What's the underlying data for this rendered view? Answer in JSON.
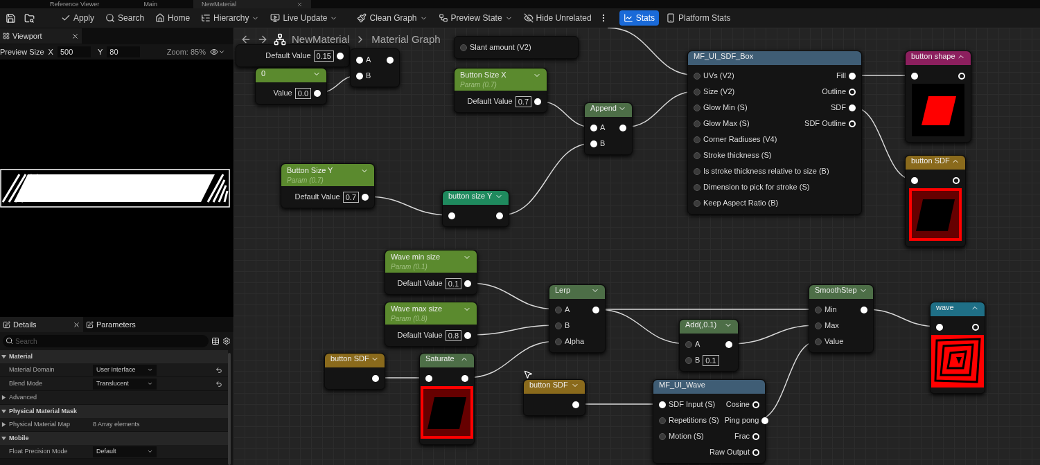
{
  "tabs": [
    {
      "label": "Reference Viewer",
      "selected": false
    },
    {
      "label": "Main",
      "selected": false
    },
    {
      "label": "NewMaterial",
      "selected": true
    }
  ],
  "toolbar": [
    {
      "label": "Apply",
      "dropdown": false,
      "selected": false
    },
    {
      "label": "Search",
      "dropdown": false,
      "selected": false
    },
    {
      "label": "Home",
      "dropdown": false,
      "selected": false
    },
    {
      "label": "Hierarchy",
      "dropdown": true,
      "selected": false
    },
    {
      "label": "Live Update",
      "dropdown": true,
      "selected": false
    },
    {
      "label": "Clean Graph",
      "dropdown": true,
      "selected": false
    },
    {
      "label": "Preview State",
      "dropdown": true,
      "selected": false
    },
    {
      "label": "Hide Unrelated",
      "dropdown": false,
      "selected": false
    },
    {
      "label": "Stats",
      "dropdown": false,
      "selected": true
    },
    {
      "label": "Platform Stats",
      "dropdown": false,
      "selected": false
    }
  ],
  "viewport": {
    "title": "Viewport",
    "preview_size_label": "Preview Size",
    "x_label": "X",
    "x_value": "500",
    "y_label": "Y",
    "y_value": "80",
    "zoom": "Zoom: 85%"
  },
  "details": {
    "tabs": [
      {
        "label": "Details",
        "selected": true
      },
      {
        "label": "Parameters",
        "selected": false
      }
    ],
    "search_placeholder": "Search",
    "sections": [
      {
        "title": "Material",
        "expanded": true,
        "rows": [
          {
            "kind": "dropdown",
            "label": "Material Domain",
            "value": "User Interface",
            "reset": true
          },
          {
            "kind": "dropdown",
            "label": "Blend Mode",
            "value": "Translucent",
            "reset": true
          },
          {
            "kind": "group",
            "label": "Advanced",
            "expanded": false
          }
        ]
      },
      {
        "title": "Physical Material Mask",
        "expanded": true,
        "rows": [
          {
            "kind": "array",
            "label": "Physical Material Map",
            "value": "8 Array elements",
            "expanded": false
          }
        ]
      },
      {
        "title": "Mobile",
        "expanded": true,
        "rows": [
          {
            "kind": "dropdown",
            "label": "Float Precision Mode",
            "value": "Default",
            "reset": false
          }
        ]
      }
    ]
  },
  "graph": {
    "breadcrumb": [
      "NewMaterial",
      "Material Graph"
    ],
    "nodes": [
      {
        "rows": [
          {
            "output": {
              "label": "Default Value",
              "value": "0.15",
              "filled": true
            }
          }
        ]
      },
      {
        "rows": [
          {
            "input": {
              "label": "A",
              "filled": true
            },
            "output": {
              "filled": true
            }
          },
          {
            "input": {
              "label": "B",
              "filled": true
            }
          }
        ]
      },
      {
        "rows": [
          {
            "input": {
              "label": "Slant amount (V2)",
              "filled": false
            }
          }
        ]
      },
      {
        "title": "0",
        "color": "#5b8a2e",
        "expanded": false,
        "rows": [
          {
            "output": {
              "label": "Value",
              "value": "0.0",
              "filled": true
            }
          }
        ]
      },
      {
        "title": "Button Size X",
        "subtitle": "Param (0.7)",
        "color": "#5b8a2e",
        "expanded": false,
        "rows": [
          {
            "output": {
              "label": "Default Value",
              "value": "0.7",
              "filled": true
            }
          }
        ]
      },
      {
        "title": "Append",
        "color": "#4d6e47",
        "expanded": false,
        "rows": [
          {
            "input": {
              "label": "A",
              "filled": true
            },
            "output": {
              "filled": true
            }
          },
          {
            "input": {
              "label": "B",
              "filled": true
            }
          }
        ]
      },
      {
        "title": "Button Size Y",
        "subtitle": "Param (0.7)",
        "color": "#5b8a2e",
        "expanded": false,
        "rows": [
          {
            "output": {
              "label": "Default Value",
              "value": "0.7",
              "filled": true
            }
          }
        ]
      },
      {
        "title": "button size Y",
        "color": "#1f8a5e",
        "expanded": false,
        "rows": [
          {
            "input": {
              "filled": true
            },
            "output": {
              "filled": true
            }
          }
        ]
      },
      {
        "title": "MF_UI_SDF_Box",
        "color": "#3f5d75",
        "rows": [
          {
            "input": {
              "label": "UVs (V2)",
              "filled": false
            },
            "output": {
              "label": "Fill",
              "filled": true
            }
          },
          {
            "input": {
              "label": "Size (V2)",
              "filled": false
            },
            "output": {
              "label": "Outline",
              "filled": false
            }
          },
          {
            "input": {
              "label": "Glow Min (S)",
              "filled": false
            },
            "output": {
              "label": "SDF",
              "filled": true
            }
          },
          {
            "input": {
              "label": "Glow Max (S)",
              "filled": false
            },
            "output": {
              "label": "SDF Outline",
              "filled": false
            }
          },
          {
            "input": {
              "label": "Corner Radiuses (V4)",
              "filled": false
            }
          },
          {
            "input": {
              "label": "Stroke thickness (S)",
              "filled": false
            }
          },
          {
            "input": {
              "label": "Is stroke thickness relative to size (B)",
              "filled": false
            }
          },
          {
            "input": {
              "label": "Dimension to pick for stroke (S)",
              "filled": false
            }
          },
          {
            "input": {
              "label": "Keep Aspect Ratio (B)",
              "filled": false
            }
          }
        ]
      },
      {
        "title": "button shape",
        "color": "#8c1f5e",
        "expanded": true,
        "kind": "fill",
        "rows": [
          {
            "input": {
              "filled": true
            },
            "output": {
              "filled": false
            }
          }
        ]
      },
      {
        "title": "button SDF",
        "color": "#8a6a1c",
        "expanded": true,
        "kind": "sdf",
        "rows": [
          {
            "input": {
              "filled": true
            },
            "output": {
              "filled": false
            }
          }
        ]
      },
      {
        "title": "Wave min size",
        "subtitle": "Param (0.1)",
        "color": "#5b8a2e",
        "expanded": false,
        "rows": [
          {
            "output": {
              "label": "Default Value",
              "value": "0.1",
              "filled": true
            }
          }
        ]
      },
      {
        "title": "Wave max size",
        "subtitle": "Param (0.8)",
        "color": "#5b8a2e",
        "expanded": false,
        "rows": [
          {
            "output": {
              "label": "Default Value",
              "value": "0.8",
              "filled": true
            }
          }
        ]
      },
      {
        "title": "button SDF",
        "color": "#8a6a1c",
        "expanded": false,
        "rows": [
          {
            "output": {
              "filled": true
            }
          }
        ]
      },
      {
        "title": "Saturate",
        "color": "#4d6e47",
        "expanded": true,
        "kind": "sdf",
        "rows": [
          {
            "input": {
              "filled": true
            },
            "output": {
              "filled": true
            }
          }
        ]
      },
      {
        "title": "Lerp",
        "color": "#4d6e47",
        "expanded": false,
        "rows": [
          {
            "input": {
              "label": "A",
              "filled": false
            },
            "output": {
              "filled": true
            }
          },
          {
            "input": {
              "label": "B",
              "filled": false
            }
          },
          {
            "input": {
              "label": "Alpha",
              "filled": false
            }
          }
        ]
      },
      {
        "title": "button SDF",
        "color": "#8a6a1c",
        "expanded": false,
        "rows": [
          {
            "output": {
              "filled": true
            }
          }
        ]
      },
      {
        "title": "Add(,0.1)",
        "color": "#4d6e47",
        "expanded": false,
        "rows": [
          {
            "input": {
              "label": "A",
              "filled": false
            },
            "output": {
              "filled": true
            }
          },
          {
            "input": {
              "label": "B",
              "value": "0.1",
              "filled": false
            }
          }
        ]
      },
      {
        "title": "MF_UI_Wave",
        "color": "#3f5d75",
        "rows": [
          {
            "input": {
              "label": "SDF Input (S)",
              "filled": true
            },
            "output": {
              "label": "Cosine",
              "filled": false
            }
          },
          {
            "input": {
              "label": "Repetitions (S)",
              "filled": false
            },
            "output": {
              "label": "Ping pong",
              "filled": true
            }
          },
          {
            "input": {
              "label": "Motion (S)",
              "filled": false
            },
            "output": {
              "label": "Frac",
              "filled": false
            }
          },
          {
            "output": {
              "label": "Raw Output",
              "filled": false
            }
          }
        ]
      },
      {
        "title": "SmoothStep",
        "color": "#4d6e47",
        "expanded": false,
        "rows": [
          {
            "input": {
              "label": "Min",
              "filled": false
            },
            "output": {
              "filled": true
            }
          },
          {
            "input": {
              "label": "Max",
              "filled": false
            }
          },
          {
            "input": {
              "label": "Value",
              "filled": false
            }
          }
        ]
      },
      {
        "title": "wave",
        "color": "#1f6f86",
        "expanded": true,
        "kind": "wave",
        "rows": [
          {
            "input": {
              "filled": true
            },
            "output": {
              "filled": false
            }
          }
        ]
      }
    ]
  }
}
